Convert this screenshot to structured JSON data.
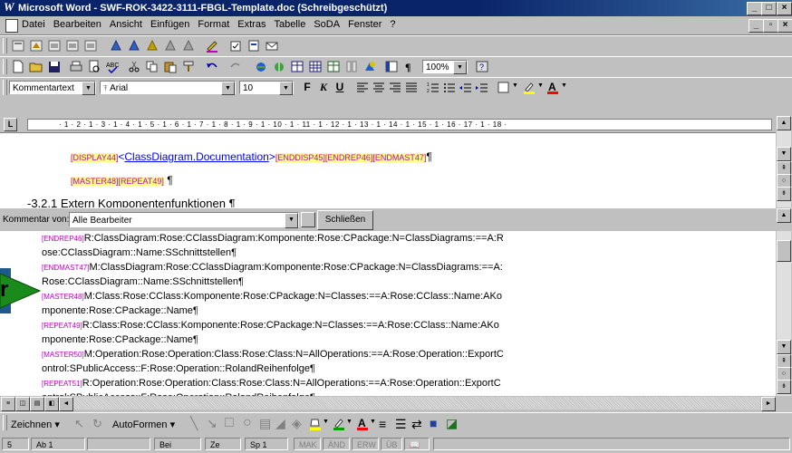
{
  "window": {
    "title": "Microsoft Word - SWF-ROK-3422-3111-FBGL-Template.doc (Schreibgeschützt)",
    "logo": "W",
    "min": "_",
    "max": "□",
    "close": "×"
  },
  "menu": [
    "Datei",
    "Bearbeiten",
    "Ansicht",
    "Einfügen",
    "Format",
    "Extras",
    "Tabelle",
    "SoDA",
    "Fenster",
    "?"
  ],
  "format_toolbar": {
    "style": "Kommentartext",
    "font": "Arial",
    "size": "10",
    "bold": "F",
    "italic": "K",
    "underline": "U"
  },
  "standard_toolbar": {
    "zoom": "100%"
  },
  "ruler": {
    "text": "· 1 · 2 · 1 · 3 · 1 · 4 · 1 · 5 · 1 · 6 · 1 · 7 · 1 · 8 · 1 · 9 · 1 · 10 · 1 · 11 · 1 · 12 · 1 · 13 · 1 · 14 · 1 · 15 · 1 · 16 · 17 · 1 · 18 ·"
  },
  "document": {
    "line1": {
      "tag1": "[DISPLAY44]",
      "lt": "<",
      "link": "ClassDiagram.Documentation",
      "gt": ">",
      "tag2": "[ENDDISP45][ENDREP46][ENDMAST47]",
      "pilcrow": "¶"
    },
    "line2": {
      "tag": "[MASTER48][REPEAT49]",
      "pilcrow": "¶"
    },
    "cutoff": "-3.2.1 Extern Komponentenfunktionen ¶"
  },
  "comment_header": {
    "label": "Kommentar von:",
    "filter": "Alle Bearbeiter",
    "close": "Schließen"
  },
  "comments": [
    {
      "tag": "[ENDREP46]",
      "text": "R:ClassDiagram:Rose:CClassDiagram:Komponente:Rose:CPackage:N=ClassDiagrams:==A:R"
    },
    {
      "tag": "",
      "text": "ose:CClassDiagram::Name:SSchnittstellen¶"
    },
    {
      "tag": "[ENDMAST47]",
      "text": "M:ClassDiagram:Rose:CClassDiagram:Komponente:Rose:CPackage:N=ClassDiagrams:==A:"
    },
    {
      "tag": "",
      "text": "Rose:CClassDiagram::Name:SSchnittstellen¶"
    },
    {
      "tag": "[MASTER48]",
      "text": "M:Class:Rose:CClass:Komponente:Rose:CPackage:N=Classes:==A:Rose:CClass::Name:AKo"
    },
    {
      "tag": "",
      "text": "mponente:Rose:CPackage::Name¶"
    },
    {
      "tag": "[REPEAT49]",
      "text": "R:Class:Rose:CClass:Komponente:Rose:CPackage:N=Classes:==A:Rose:CClass::Name:AKo"
    },
    {
      "tag": "",
      "text": "mponente:Rose:CPackage::Name¶"
    },
    {
      "tag": "[MASTER50]",
      "text": "M:Operation:Rose:Operation:Class:Rose:Class:N=AllOperations:==A:Rose:Operation::ExportC"
    },
    {
      "tag": "",
      "text": "ontrol:SPublicAccess::F:Rose:Operation::RolandReihenfolge¶"
    },
    {
      "tag": "[REPEAT51]",
      "text": "R:Operation:Rose:Operation:Class:Rose:Class:N=AllOperations:==A:Rose:Operation::ExportC"
    },
    {
      "tag": "",
      "text": "ontrol:SPublicAccess::F:Rose:Operation::RolandReihenfolge¶"
    }
  ],
  "overlay_letter": "r",
  "drawing": {
    "zeichnen": "Zeichnen",
    "autoformen": "AutoFormen"
  },
  "status": {
    "page": "5",
    "section": "Ab 1",
    "page_of": "",
    "at": "Bei",
    "line": "Ze",
    "col": "Sp 1",
    "mak": "MAK",
    "aend": "ÄND",
    "erw": "ERW",
    "ub": "ÜB"
  },
  "colors": {
    "title_bar": "#0a246a",
    "tag": "#c000c0",
    "link": "#0000ff",
    "overlay": "#1a8a1a"
  }
}
